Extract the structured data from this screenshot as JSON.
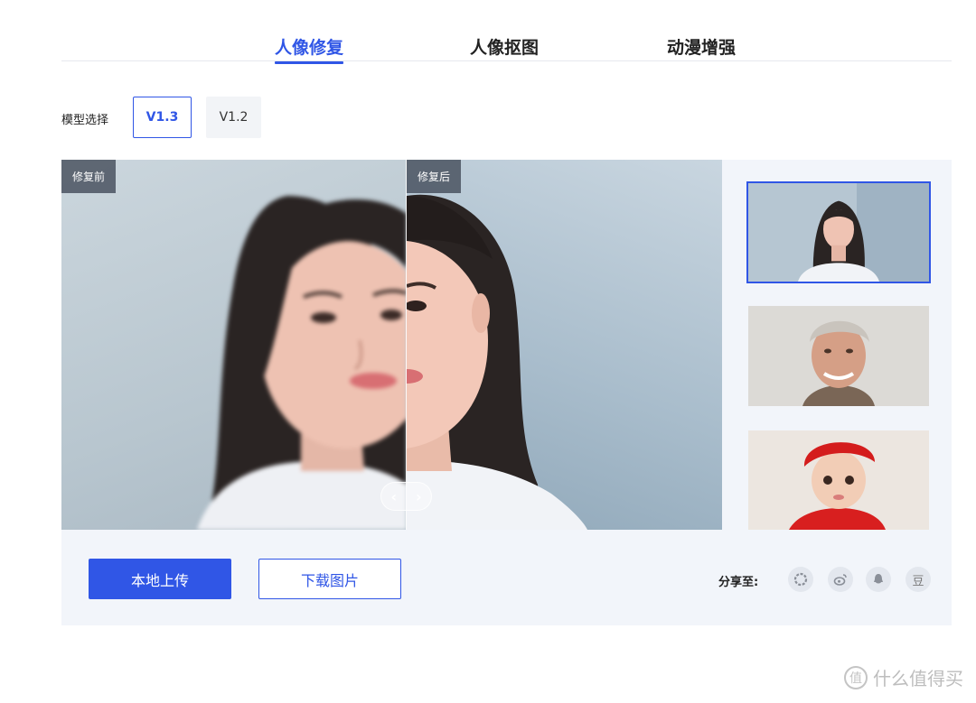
{
  "tabs": [
    {
      "label": "人像修复",
      "active": true
    },
    {
      "label": "人像抠图",
      "active": false
    },
    {
      "label": "动漫增强",
      "active": false
    }
  ],
  "model": {
    "label": "模型选择",
    "options": [
      "V1.3",
      "V1.2"
    ],
    "selected": "V1.3"
  },
  "compare": {
    "before_tag": "修复前",
    "after_tag": "修复后",
    "handle_left": "‹",
    "handle_right": "›"
  },
  "thumbnails": [
    {
      "name": "young-woman",
      "selected": true
    },
    {
      "name": "older-man",
      "selected": false
    },
    {
      "name": "baby-red-hat",
      "selected": false
    }
  ],
  "actions": {
    "upload_label": "本地上传",
    "download_label": "下载图片"
  },
  "share": {
    "label": "分享至:",
    "icons": [
      "moments-icon",
      "weibo-icon",
      "qq-icon",
      "douban-icon"
    ],
    "douban_glyph": "豆"
  },
  "watermark": {
    "mark": "值",
    "text": "什么值得买"
  },
  "colors": {
    "accent": "#3056e6",
    "panel_bg": "#f2f5fa"
  }
}
